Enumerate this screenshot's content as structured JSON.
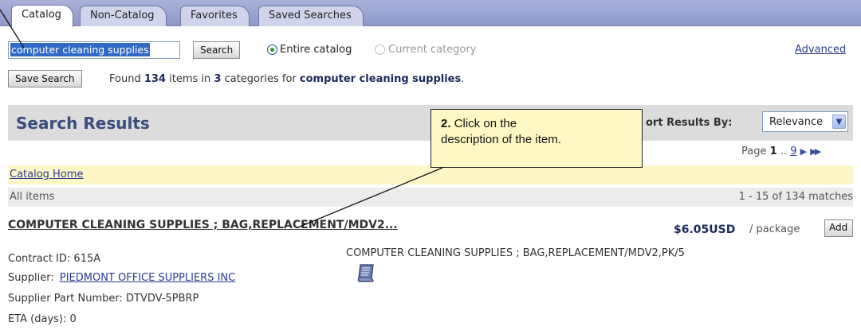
{
  "tabs": [
    {
      "label": "Catalog"
    },
    {
      "label": "Non-Catalog"
    },
    {
      "label": "Favorites"
    },
    {
      "label": "Saved Searches"
    }
  ],
  "search": {
    "value": "computer cleaning supplies",
    "button": "Search",
    "scope_entire": "Entire catalog",
    "scope_current": "Current category",
    "advanced": "Advanced",
    "save_button": "Save Search",
    "found_prefix": "Found",
    "found_count": "134",
    "found_mid1": "items in",
    "found_categories": "3",
    "found_mid2": "categories for",
    "found_query": "computer cleaning supplies",
    "found_end": "."
  },
  "results": {
    "title": "Search Results",
    "sort_label": "ort Results By:",
    "sort_value": "Relevance",
    "page_label": "Page",
    "page_current": "1",
    "page_sep": "..",
    "page_last": "9",
    "catalog_home": "Catalog Home",
    "all_items": "All items",
    "range": "1 - 15 of 134 matches"
  },
  "item": {
    "title": "COMPUTER CLEANING SUPPLIES ; BAG,REPLACEMENT/MDV2...",
    "price": "$6.05USD",
    "unit": "/ package",
    "add": "Add",
    "contract_label": "Contract ID:",
    "contract_id": "615A",
    "supplier_label": "Supplier:",
    "supplier": "PIEDMONT OFFICE SUPPLIERS INC",
    "part_label": "Supplier Part Number:",
    "part": "DTVDV-5PBRP",
    "eta_label": "ETA (days):",
    "eta": "0",
    "description": "COMPUTER CLEANING SUPPLIES ; BAG,REPLACEMENT/MDV2,PK/5",
    "icon": "document-scroll-icon"
  },
  "callout": {
    "step": "2.",
    "text1": "Click on the",
    "text2": "description of the item."
  },
  "colors": {
    "tabbar": "#a9b1da",
    "accent": "#3b4d7a",
    "callout_bg": "#fff8c4",
    "home_bar": "#fdf7c7"
  }
}
